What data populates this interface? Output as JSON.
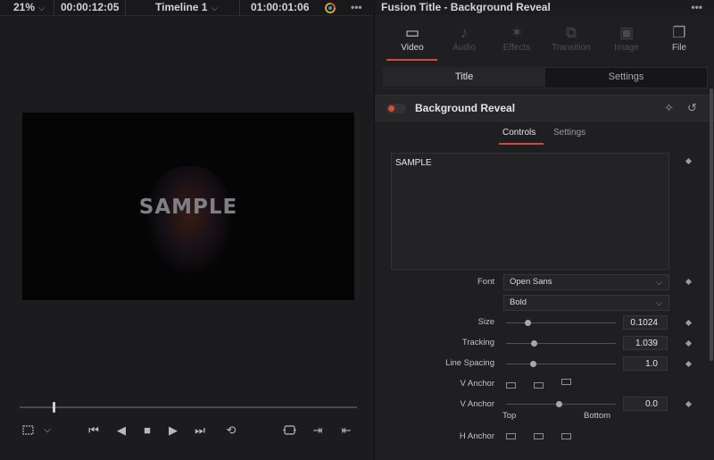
{
  "viewer": {
    "zoom": "21%",
    "timecode_left": "00:00:12:05",
    "timeline_name": "Timeline 1",
    "timecode_right": "01:00:01:06",
    "more": "•••",
    "canvas_text": "SAMPLE",
    "playhead_position": 0.1
  },
  "inspector": {
    "title": "Fusion Title - Background Reveal",
    "more": "•••",
    "tabs": [
      {
        "label": "Video",
        "icon": "film-icon",
        "glyph": "▭",
        "state": "active"
      },
      {
        "label": "Audio",
        "icon": "music-note-icon",
        "glyph": "♪",
        "state": "disabled"
      },
      {
        "label": "Effects",
        "icon": "effects-icon",
        "glyph": "✶",
        "state": "disabled"
      },
      {
        "label": "Transition",
        "icon": "transition-icon",
        "glyph": "⧉",
        "state": "disabled"
      },
      {
        "label": "Image",
        "icon": "image-icon",
        "glyph": "▣",
        "state": "disabled"
      },
      {
        "label": "File",
        "icon": "file-icon",
        "glyph": "❒",
        "state": "enabled"
      }
    ],
    "segment": {
      "left": "Title",
      "right": "Settings"
    },
    "section_title": "Background Reveal",
    "subtabs": {
      "controls": "Controls",
      "settings": "Settings"
    },
    "text_value": "SAMPLE",
    "font_label": "Font",
    "font_value": "Open Sans",
    "style_value": "Bold",
    "size_label": "Size",
    "size_value": "0.1024",
    "tracking_label": "Tracking",
    "tracking_value": "1.039",
    "line_spacing_label": "Line Spacing",
    "line_spacing_value": "1.0",
    "v_anchor_label": "V Anchor",
    "v_anchor2_label": "V Anchor",
    "v_anchor2_value": "0.0",
    "top_label": "Top",
    "bottom_label": "Bottom",
    "h_anchor_label": "H Anchor",
    "accent_color": "#d24a38"
  }
}
